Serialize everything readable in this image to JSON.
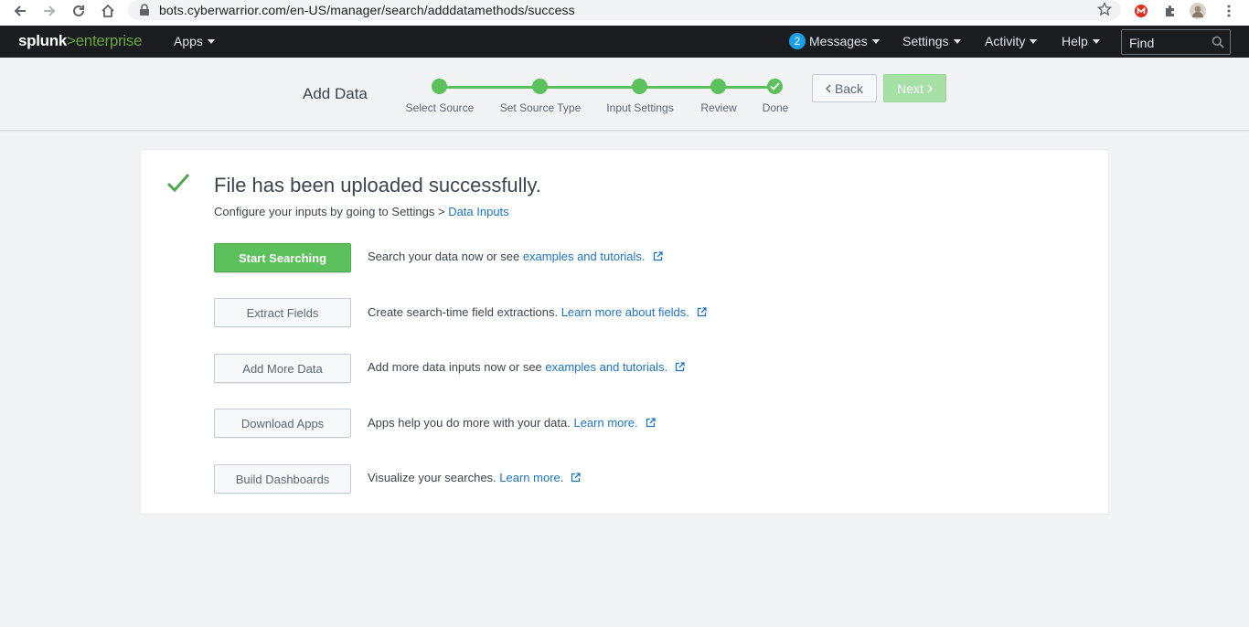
{
  "browser": {
    "url": "bots.cyberwarrior.com/en-US/manager/search/adddatamethods/success"
  },
  "splunk_bar": {
    "logo_splunk": "splunk",
    "logo_gt": ">",
    "logo_product": "enterprise",
    "apps_label": "Apps",
    "messages_count": "2",
    "messages_label": "Messages",
    "settings_label": "Settings",
    "activity_label": "Activity",
    "help_label": "Help",
    "find_placeholder": "Find"
  },
  "wizard": {
    "title": "Add Data",
    "steps": [
      {
        "label": "Select Source"
      },
      {
        "label": "Set Source Type"
      },
      {
        "label": "Input Settings"
      },
      {
        "label": "Review"
      },
      {
        "label": "Done"
      }
    ],
    "back_label": "Back",
    "next_label": "Next"
  },
  "success": {
    "title": "File has been uploaded successfully.",
    "subtitle_prefix": "Configure your inputs by going to Settings > ",
    "subtitle_link": "Data Inputs"
  },
  "actions": [
    {
      "button": "Start Searching",
      "text": "Search your data now or see ",
      "link": "examples and tutorials."
    },
    {
      "button": "Extract Fields",
      "text": "Create search-time field extractions. ",
      "link": "Learn more about fields."
    },
    {
      "button": "Add More Data",
      "text": "Add more data inputs now or see ",
      "link": "examples and tutorials."
    },
    {
      "button": "Download Apps",
      "text": "Apps help you do more with your data. ",
      "link": "Learn more."
    },
    {
      "button": "Build Dashboards",
      "text": "Visualize your searches. ",
      "link": "Learn more."
    }
  ],
  "colors": {
    "accent_green": "#5cc05c",
    "link_blue": "#1e73be",
    "bar_dark": "#1a1c20"
  }
}
